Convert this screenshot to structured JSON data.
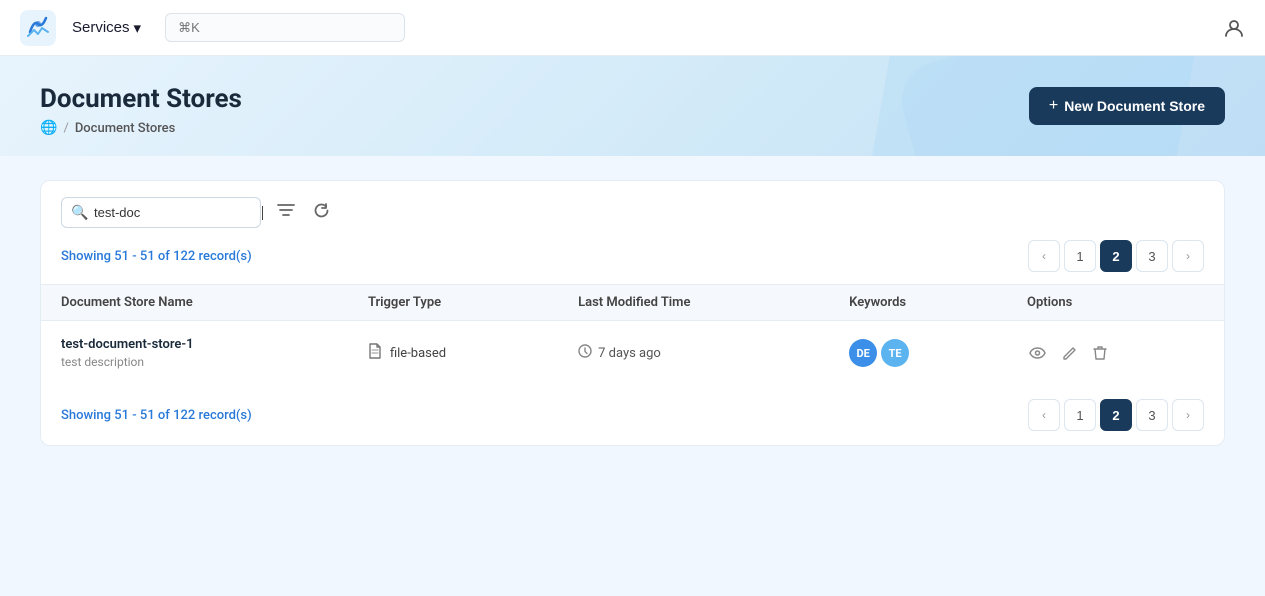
{
  "navbar": {
    "services_label": "Services",
    "search_placeholder": "⌘K",
    "user_icon": "user-icon"
  },
  "header": {
    "title": "Document Stores",
    "new_button_label": "New Document Store",
    "breadcrumb_root": "🌐",
    "breadcrumb_sep": "/",
    "breadcrumb_current": "Document Stores"
  },
  "toolbar": {
    "search_value": "test-doc",
    "filter_icon": "≡",
    "refresh_icon": "↻"
  },
  "table": {
    "records_text_top": "Showing 51 - 51 of 122 record(s)",
    "records_text_bottom": "Showing 51 - 51 of 122 record(s)",
    "columns": [
      "Document Store Name",
      "Trigger Type",
      "Last Modified Time",
      "Keywords",
      "Options"
    ],
    "rows": [
      {
        "name": "test-document-store-1",
        "description": "test description",
        "trigger_type": "file-based",
        "last_modified": "7 days ago",
        "keywords": [
          "DE",
          "TE"
        ]
      }
    ]
  },
  "pagination": {
    "prev_label": "‹",
    "next_label": "›",
    "pages": [
      "1",
      "2",
      "3"
    ],
    "active_page": "2"
  }
}
